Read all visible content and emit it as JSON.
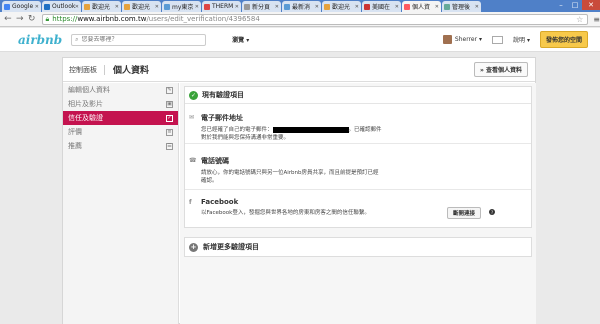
{
  "browser": {
    "tabs": [
      {
        "title": "Google",
        "color": "#4285f4",
        "active": false
      },
      {
        "title": "Outlook",
        "color": "#1e6fc4",
        "active": false
      },
      {
        "title": "歡迎光",
        "color": "#e6a23c",
        "active": false
      },
      {
        "title": "歡迎光",
        "color": "#e6a23c",
        "active": false
      },
      {
        "title": "my東京",
        "color": "#5b9bd5",
        "active": false
      },
      {
        "title": "THERM",
        "color": "#d44",
        "active": false
      },
      {
        "title": "新分頁",
        "color": "#999",
        "active": false
      },
      {
        "title": "最新消",
        "color": "#5b9bd5",
        "active": false
      },
      {
        "title": "歡迎光",
        "color": "#e6a23c",
        "active": false
      },
      {
        "title": "美國在",
        "color": "#c33",
        "active": false
      },
      {
        "title": "個人資",
        "color": "#ff5a5f",
        "active": true
      },
      {
        "title": "管理後",
        "color": "#6a9",
        "active": false
      }
    ],
    "url_scheme": "https://",
    "url_host": "www.airbnb.com.tw",
    "url_path": "/users/edit_verification/4396584"
  },
  "header": {
    "logo": "airbnb",
    "search_placeholder": "您要去哪裡？",
    "browse": "瀏覽",
    "username": "Sherrer",
    "help": "說明",
    "list_space": "發佈您的空間"
  },
  "page": {
    "breadcrumb": "控制面板",
    "title": "個人資料",
    "view_profile": "查看個人資料"
  },
  "sidebar": {
    "items": [
      {
        "label": "編輯個人資料",
        "icon": "✎",
        "active": false
      },
      {
        "label": "相片及影片",
        "icon": "▣",
        "active": false
      },
      {
        "label": "信任及驗證",
        "icon": "✓",
        "active": true
      },
      {
        "label": "評價",
        "icon": "≡",
        "active": false
      },
      {
        "label": "推薦",
        "icon": "☰",
        "active": false
      }
    ]
  },
  "verifications": {
    "heading": "現有驗證項目",
    "email": {
      "title": "電子郵件地址",
      "text_before": "您已經確了自己的電子郵件：",
      "text_after": "。已確認郵件",
      "text_line2": "對於我們能與您保持溝通非常重要。"
    },
    "phone": {
      "title": "電話號碼",
      "text_line1": "請放心，你的電話號碼只與另一位Airbnb房員共享，而且前提是預訂已經",
      "text_line2": "確認。"
    },
    "facebook": {
      "title": "Facebook",
      "text": "以Facebook登入，發掘您與世界各地的房東和房客之間的信任聯繫。",
      "disconnect": "斷開連接"
    }
  },
  "add_more": "新增更多驗證項目"
}
